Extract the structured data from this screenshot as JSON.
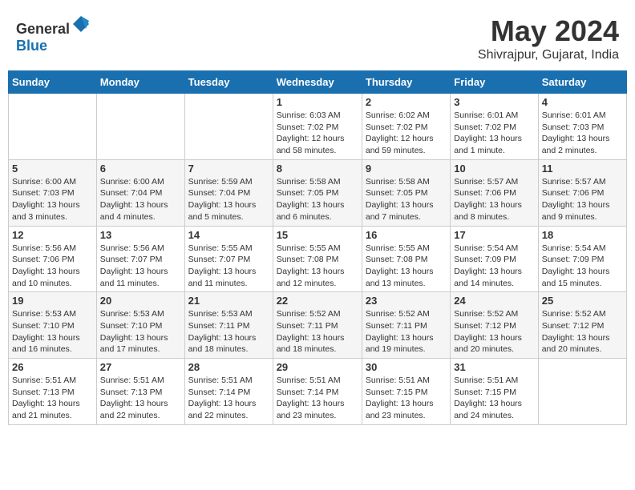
{
  "header": {
    "logo_general": "General",
    "logo_blue": "Blue",
    "title": "May 2024",
    "subtitle": "Shivrajpur, Gujarat, India"
  },
  "days_of_week": [
    "Sunday",
    "Monday",
    "Tuesday",
    "Wednesday",
    "Thursday",
    "Friday",
    "Saturday"
  ],
  "weeks": [
    [
      {
        "day": "",
        "info": ""
      },
      {
        "day": "",
        "info": ""
      },
      {
        "day": "",
        "info": ""
      },
      {
        "day": "1",
        "info": "Sunrise: 6:03 AM\nSunset: 7:02 PM\nDaylight: 12 hours and 58 minutes."
      },
      {
        "day": "2",
        "info": "Sunrise: 6:02 AM\nSunset: 7:02 PM\nDaylight: 12 hours and 59 minutes."
      },
      {
        "day": "3",
        "info": "Sunrise: 6:01 AM\nSunset: 7:02 PM\nDaylight: 13 hours and 1 minute."
      },
      {
        "day": "4",
        "info": "Sunrise: 6:01 AM\nSunset: 7:03 PM\nDaylight: 13 hours and 2 minutes."
      }
    ],
    [
      {
        "day": "5",
        "info": "Sunrise: 6:00 AM\nSunset: 7:03 PM\nDaylight: 13 hours and 3 minutes."
      },
      {
        "day": "6",
        "info": "Sunrise: 6:00 AM\nSunset: 7:04 PM\nDaylight: 13 hours and 4 minutes."
      },
      {
        "day": "7",
        "info": "Sunrise: 5:59 AM\nSunset: 7:04 PM\nDaylight: 13 hours and 5 minutes."
      },
      {
        "day": "8",
        "info": "Sunrise: 5:58 AM\nSunset: 7:05 PM\nDaylight: 13 hours and 6 minutes."
      },
      {
        "day": "9",
        "info": "Sunrise: 5:58 AM\nSunset: 7:05 PM\nDaylight: 13 hours and 7 minutes."
      },
      {
        "day": "10",
        "info": "Sunrise: 5:57 AM\nSunset: 7:06 PM\nDaylight: 13 hours and 8 minutes."
      },
      {
        "day": "11",
        "info": "Sunrise: 5:57 AM\nSunset: 7:06 PM\nDaylight: 13 hours and 9 minutes."
      }
    ],
    [
      {
        "day": "12",
        "info": "Sunrise: 5:56 AM\nSunset: 7:06 PM\nDaylight: 13 hours and 10 minutes."
      },
      {
        "day": "13",
        "info": "Sunrise: 5:56 AM\nSunset: 7:07 PM\nDaylight: 13 hours and 11 minutes."
      },
      {
        "day": "14",
        "info": "Sunrise: 5:55 AM\nSunset: 7:07 PM\nDaylight: 13 hours and 11 minutes."
      },
      {
        "day": "15",
        "info": "Sunrise: 5:55 AM\nSunset: 7:08 PM\nDaylight: 13 hours and 12 minutes."
      },
      {
        "day": "16",
        "info": "Sunrise: 5:55 AM\nSunset: 7:08 PM\nDaylight: 13 hours and 13 minutes."
      },
      {
        "day": "17",
        "info": "Sunrise: 5:54 AM\nSunset: 7:09 PM\nDaylight: 13 hours and 14 minutes."
      },
      {
        "day": "18",
        "info": "Sunrise: 5:54 AM\nSunset: 7:09 PM\nDaylight: 13 hours and 15 minutes."
      }
    ],
    [
      {
        "day": "19",
        "info": "Sunrise: 5:53 AM\nSunset: 7:10 PM\nDaylight: 13 hours and 16 minutes."
      },
      {
        "day": "20",
        "info": "Sunrise: 5:53 AM\nSunset: 7:10 PM\nDaylight: 13 hours and 17 minutes."
      },
      {
        "day": "21",
        "info": "Sunrise: 5:53 AM\nSunset: 7:11 PM\nDaylight: 13 hours and 18 minutes."
      },
      {
        "day": "22",
        "info": "Sunrise: 5:52 AM\nSunset: 7:11 PM\nDaylight: 13 hours and 18 minutes."
      },
      {
        "day": "23",
        "info": "Sunrise: 5:52 AM\nSunset: 7:11 PM\nDaylight: 13 hours and 19 minutes."
      },
      {
        "day": "24",
        "info": "Sunrise: 5:52 AM\nSunset: 7:12 PM\nDaylight: 13 hours and 20 minutes."
      },
      {
        "day": "25",
        "info": "Sunrise: 5:52 AM\nSunset: 7:12 PM\nDaylight: 13 hours and 20 minutes."
      }
    ],
    [
      {
        "day": "26",
        "info": "Sunrise: 5:51 AM\nSunset: 7:13 PM\nDaylight: 13 hours and 21 minutes."
      },
      {
        "day": "27",
        "info": "Sunrise: 5:51 AM\nSunset: 7:13 PM\nDaylight: 13 hours and 22 minutes."
      },
      {
        "day": "28",
        "info": "Sunrise: 5:51 AM\nSunset: 7:14 PM\nDaylight: 13 hours and 22 minutes."
      },
      {
        "day": "29",
        "info": "Sunrise: 5:51 AM\nSunset: 7:14 PM\nDaylight: 13 hours and 23 minutes."
      },
      {
        "day": "30",
        "info": "Sunrise: 5:51 AM\nSunset: 7:15 PM\nDaylight: 13 hours and 23 minutes."
      },
      {
        "day": "31",
        "info": "Sunrise: 5:51 AM\nSunset: 7:15 PM\nDaylight: 13 hours and 24 minutes."
      },
      {
        "day": "",
        "info": ""
      }
    ]
  ]
}
